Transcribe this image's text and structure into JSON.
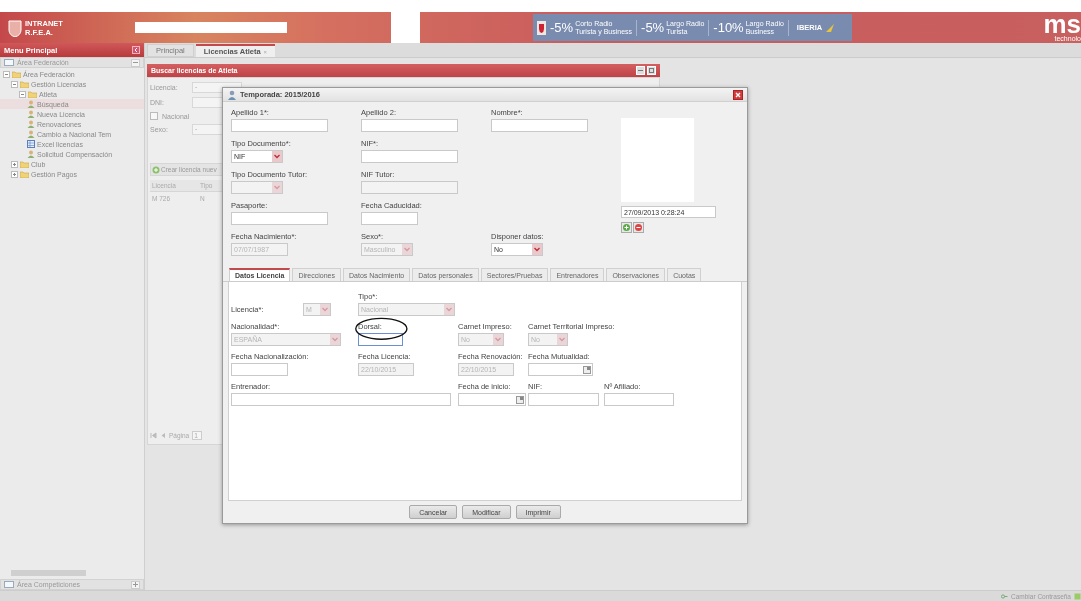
{
  "header": {
    "logo_lines": [
      "INTRANET",
      "R.F.E.A."
    ],
    "banner": {
      "offers": [
        {
          "discount": "-5%",
          "lines": [
            "Corto Radio",
            "Turista y Business"
          ]
        },
        {
          "discount": "-5%",
          "lines": [
            "Largo Radio",
            "Turista"
          ]
        },
        {
          "discount": "-10%",
          "lines": [
            "Largo Radio",
            "Business"
          ]
        }
      ],
      "airline": "IBERIA"
    },
    "brand": "ms",
    "brand_tagline": "technolo"
  },
  "sidebar": {
    "title": "Menu Principal",
    "sections": [
      {
        "label": "Área Federación",
        "expanded": true,
        "tree": [
          {
            "label": "Área Federación",
            "kind": "folder",
            "expanded": true,
            "children": [
              {
                "label": "Gestión Licencias",
                "kind": "folder",
                "expanded": true,
                "children": [
                  {
                    "label": "Atleta",
                    "kind": "folder",
                    "expanded": true,
                    "children": [
                      {
                        "label": "Búsqueda",
                        "kind": "item",
                        "selected": true
                      },
                      {
                        "label": "Nueva Licencia",
                        "kind": "item",
                        "selected": false
                      },
                      {
                        "label": "Renovaciones",
                        "kind": "item",
                        "selected": false
                      },
                      {
                        "label": "Cambio a Nacional Tem",
                        "kind": "item",
                        "selected": false
                      },
                      {
                        "label": "Excel licencias",
                        "kind": "sheet",
                        "selected": false
                      },
                      {
                        "label": "Solicitud Compensación",
                        "kind": "item",
                        "selected": false
                      }
                    ]
                  }
                ]
              },
              {
                "label": "Club",
                "kind": "folder",
                "expanded": false
              },
              {
                "label": "Gestión Pagos",
                "kind": "folder",
                "expanded": false
              }
            ]
          }
        ]
      },
      {
        "label": "Área Competiciones",
        "expanded": false
      }
    ]
  },
  "tabs": [
    {
      "label": "Principal",
      "selected": false
    },
    {
      "label": "Licencias Atleta",
      "selected": true,
      "close": "×"
    }
  ],
  "search_panel": {
    "title": "Buscar licencias de Atleta",
    "filters": [
      {
        "label": "Licencia:",
        "value": "-"
      },
      {
        "label": "DNI:"
      }
    ],
    "nacional": {
      "label": "Nacional",
      "checked": false
    },
    "sexo": {
      "label": "Sexo:",
      "value": "-"
    },
    "create_label": "Crear licencia nuev",
    "grid": {
      "columns": [
        "Licencia",
        "Tipo"
      ],
      "rows": [
        [
          "M 726",
          "N"
        ]
      ]
    },
    "pager": {
      "label": "Página",
      "page": "1"
    }
  },
  "modal": {
    "title": "Temporada: 2015/2016",
    "rows": [
      [
        {
          "label": "Apellido 1*:",
          "kind": "text",
          "disabled": false
        },
        {
          "label": "Apellido 2:",
          "kind": "text",
          "disabled": false
        },
        {
          "label": "Nombre*:",
          "kind": "text",
          "disabled": false
        }
      ],
      [
        {
          "label": "Tipo Documento*:",
          "kind": "select",
          "value": "NIF",
          "disabled": false
        },
        {
          "label": "NIF*:",
          "kind": "text",
          "disabled": false
        }
      ],
      [
        {
          "label": "Tipo Documento Tutor:",
          "kind": "select",
          "disabled": true
        },
        {
          "label": "NIF Tutor:",
          "kind": "text",
          "disabled": true
        }
      ],
      [
        {
          "label": "Pasaporte:",
          "kind": "text",
          "disabled": false
        },
        {
          "label": "Fecha Caducidad:",
          "kind": "text",
          "disabled": false
        }
      ],
      [
        {
          "label": "Fecha Nacimiento*:",
          "kind": "text",
          "value": "07/07/1987",
          "disabled": true
        },
        {
          "label": "Sexo*:",
          "kind": "select",
          "value": "Masculino",
          "disabled": true
        },
        {
          "label": "Disponer datos:",
          "kind": "select",
          "value": "No",
          "disabled": false
        }
      ]
    ],
    "photo_date": "27/09/2013 0:28:24",
    "tabs": [
      {
        "label": "Datos Licencia",
        "selected": true
      },
      {
        "label": "Direcciones",
        "selected": false
      },
      {
        "label": "Datos Nacimiento",
        "selected": false
      },
      {
        "label": "Datos personales",
        "selected": false
      },
      {
        "label": "Sectores/Pruebas",
        "selected": false
      },
      {
        "label": "Entrenadores",
        "selected": false
      },
      {
        "label": "Observaciones",
        "selected": false
      },
      {
        "label": "Cuotas",
        "selected": false
      }
    ],
    "panel_rows": [
      [
        {
          "label": "Licencia*:",
          "kind": "select",
          "value": "M",
          "disabled": true,
          "focused": false
        },
        {
          "label": "Tipo*:",
          "kind": "select",
          "value": "Nacional",
          "disabled": true,
          "focused": false
        }
      ],
      [
        {
          "label": "Nacionalidad*:",
          "kind": "select",
          "value": "ESPAÑA",
          "disabled": true,
          "focused": false
        },
        {
          "label": "Dorsal:",
          "kind": "text",
          "disabled": false,
          "focused": true
        },
        {
          "label": "Carnet Impreso:",
          "kind": "select",
          "value": "No",
          "disabled": true,
          "focused": false
        },
        {
          "label": "Carnet Territorial Impreso:",
          "kind": "select",
          "value": "No",
          "disabled": true,
          "focused": false
        }
      ],
      [
        {
          "label": "Fecha Nacionalización:",
          "kind": "text",
          "disabled": false,
          "focused": false
        },
        {
          "label": "Fecha Licencia:",
          "kind": "text",
          "value": "22/10/2015",
          "disabled": true,
          "focused": false
        },
        {
          "label": "Fecha Renovación:",
          "kind": "text",
          "value": "22/10/2015",
          "disabled": true,
          "focused": false
        },
        {
          "label": "Fecha Mutualidad:",
          "kind": "date",
          "disabled": false,
          "focused": false
        }
      ],
      [
        {
          "label": "Entrenador:",
          "kind": "text",
          "disabled": false,
          "focused": false
        },
        {
          "label": "Fecha de inicio:",
          "kind": "date",
          "disabled": false,
          "focused": false
        },
        {
          "label": "NIF:",
          "kind": "text",
          "disabled": false,
          "focused": false
        },
        {
          "label": "Nº Afiliado:",
          "kind": "text",
          "disabled": false,
          "focused": false
        }
      ]
    ],
    "buttons": [
      "Cancelar",
      "Modificar",
      "Imprimir"
    ]
  },
  "status_bar": {
    "link": "Cambiar Contraseña"
  }
}
